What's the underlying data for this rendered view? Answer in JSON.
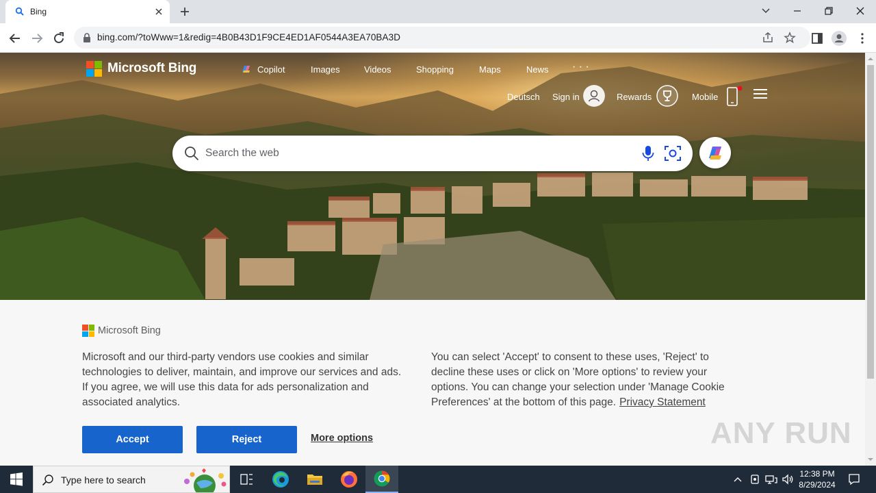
{
  "browser": {
    "tab_title": "Bing",
    "url": "bing.com/?toWww=1&redig=4B0B43D1F9CE4ED1AF0544A3EA70BA3D"
  },
  "bing": {
    "brand": "Microsoft Bing",
    "nav": [
      {
        "label": "Copilot"
      },
      {
        "label": "Images"
      },
      {
        "label": "Videos"
      },
      {
        "label": "Shopping"
      },
      {
        "label": "Maps"
      },
      {
        "label": "News"
      },
      {
        "label": "· · ·"
      }
    ],
    "language": "Deutsch",
    "sign_in": "Sign in",
    "rewards": "Rewards",
    "mobile": "Mobile",
    "search_placeholder": "Search the web"
  },
  "cookie": {
    "logo_label": "Microsoft Bing",
    "left_text": "Microsoft and our third-party vendors use cookies and similar technologies to deliver, maintain, and improve our services and ads. If you agree, we will use this data for ads personalization and associated analytics.",
    "right_text": "You can select 'Accept' to consent to these uses, 'Reject' to decline these uses or click on 'More options' to review your options. You can change your selection under 'Manage Cookie Preferences' at the bottom of this page.",
    "privacy_link": "Privacy Statement",
    "accept": "Accept",
    "reject": "Reject",
    "more_options": "More options"
  },
  "watermark": "ANY RUN",
  "taskbar": {
    "search_placeholder": "Type here to search",
    "time": "12:38 PM",
    "date": "8/29/2024"
  },
  "colors": {
    "accent": "#1765cc",
    "ms_red": "#f25022",
    "ms_green": "#7fba00",
    "ms_blue": "#00a4ef",
    "ms_yellow": "#ffb900"
  }
}
